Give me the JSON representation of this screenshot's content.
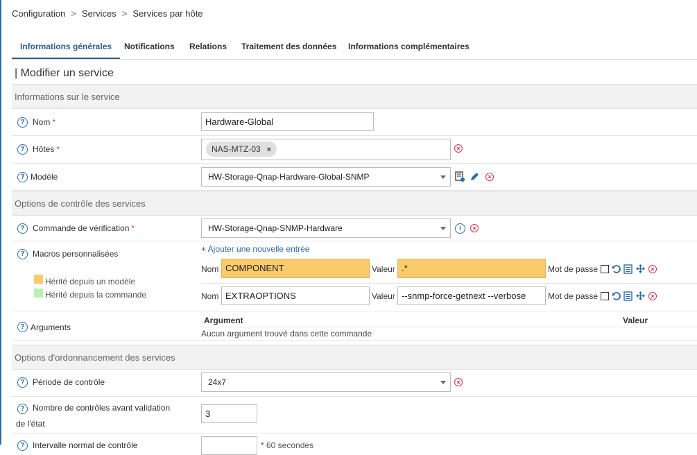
{
  "breadcrumb": [
    "Configuration",
    ">",
    "Services",
    ">",
    "Services par hôte"
  ],
  "tabs": [
    {
      "label": "Informations générales",
      "active": true
    },
    {
      "label": "Notifications"
    },
    {
      "label": "Relations"
    },
    {
      "label": "Traitement des données"
    },
    {
      "label": "Informations complémentaires"
    }
  ],
  "page_title": "| Modifier un service",
  "sections": {
    "service_info": "Informations sur le service",
    "control_options": "Options de contrôle des services",
    "scheduling_options": "Options d'ordonnancement des services"
  },
  "fields": {
    "name": {
      "label": "Nom",
      "required": "*",
      "value": "Hardware-Global"
    },
    "hosts": {
      "label": "Hôtes",
      "required": "*",
      "chip": "NAS-MTZ-03",
      "chip_remove": "×"
    },
    "template": {
      "label": "Modèle",
      "value": "HW-Storage-Qnap-Hardware-Global-SNMP"
    },
    "check_command": {
      "label": "Commande de vérification",
      "required": "*",
      "value": "HW-Storage-Qnap-SNMP-Hardware"
    },
    "macros": {
      "label": "Macros personnalisées",
      "add_link": "+ Ajouter une nouvelle entrée",
      "legend_template": "Hérité depuis un modèle",
      "legend_command": "Hérité depuis la commande",
      "name_label": "Nom",
      "value_label": "Valeur",
      "password_label": "Mot de passe",
      "entries": [
        {
          "name": "COMPONENT",
          "value": ".*",
          "inherited": "template"
        },
        {
          "name": "EXTRAOPTIONS",
          "value": "--snmp-force-getnext --verbose",
          "inherited": "none"
        }
      ]
    },
    "arguments": {
      "label": "Arguments",
      "col_argument": "Argument",
      "col_value": "Valeur",
      "empty": "Aucun argument trouvé dans cette commande"
    },
    "check_period": {
      "label": "Période de contrôle",
      "value": "24x7"
    },
    "max_check_attempts": {
      "label_line1": "Nombre de contrôles avant validation",
      "label_line2": "de l'état",
      "value": "3"
    },
    "normal_interval": {
      "label": "Intervalle normal de contrôle",
      "suffix": "* 60 secondes"
    }
  },
  "icons": {
    "help": "?",
    "remove": "×",
    "info": "i"
  },
  "colors": {
    "accent": "#2e5e8e",
    "template_inherited": "#f9cb6b",
    "command_inherited": "#b7f0b1",
    "remove": "#d32f4f"
  }
}
